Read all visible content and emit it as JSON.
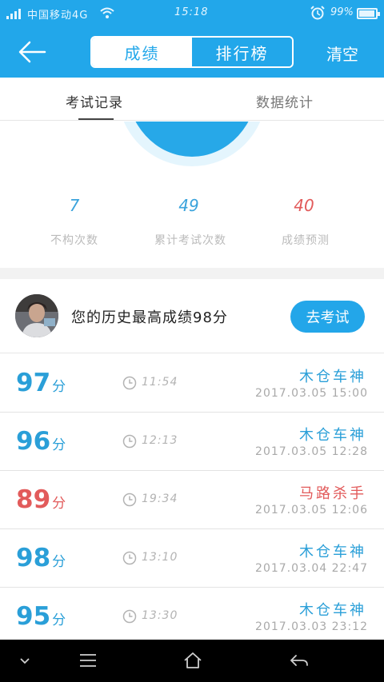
{
  "status_bar": {
    "carrier": "中国移动4G",
    "time": "15:18",
    "battery": "99%"
  },
  "header": {
    "tabs": [
      {
        "label": "成绩",
        "active": true
      },
      {
        "label": "排行榜",
        "active": false
      }
    ],
    "clear_label": "清空"
  },
  "sub_tabs": [
    {
      "label": "考试记录",
      "active": true
    },
    {
      "label": "数据统计",
      "active": false
    }
  ],
  "stats": [
    {
      "value": "7",
      "label": "不构次数",
      "color": "#3aa3dc"
    },
    {
      "value": "49",
      "label": "累计考试次数",
      "color": "#3aa3dc"
    },
    {
      "value": "40",
      "label": "成绩预测",
      "color": "#e25b5b"
    }
  ],
  "best": {
    "text": "您的历史最高成绩98分",
    "button_label": "去考试"
  },
  "records": [
    {
      "score": "97",
      "unit": "分",
      "duration": "11:54",
      "title": "木仓车神",
      "date": "2017.03.05  15:00",
      "color": "#2a9fd8"
    },
    {
      "score": "96",
      "unit": "分",
      "duration": "12:13",
      "title": "木仓车神",
      "date": "2017.03.05  12:28",
      "color": "#2a9fd8"
    },
    {
      "score": "89",
      "unit": "分",
      "duration": "19:34",
      "title": "马路杀手",
      "date": "2017.03.05  12:06",
      "color": "#e25b5b"
    },
    {
      "score": "98",
      "unit": "分",
      "duration": "13:10",
      "title": "木仓车神",
      "date": "2017.03.04  22:47",
      "color": "#2a9fd8"
    },
    {
      "score": "95",
      "unit": "分",
      "duration": "13:30",
      "title": "木仓车神",
      "date": "2017.03.03  23:12",
      "color": "#2a9fd8"
    }
  ],
  "colors": {
    "primary": "#22a7ea",
    "danger": "#e25b5b"
  },
  "nav": [
    "chevron-down-icon",
    "menu-icon",
    "home-icon",
    "back-icon"
  ]
}
